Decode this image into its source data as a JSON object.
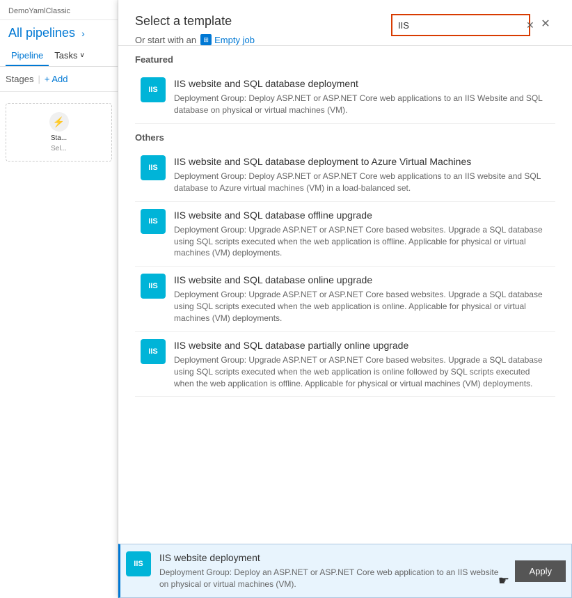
{
  "sidebar": {
    "project_name": "DemoYamlClassic",
    "title": "All pipelines",
    "breadcrumb_chevron": "›",
    "tabs": [
      {
        "label": "Pipeline",
        "active": true
      },
      {
        "label": "Tasks",
        "active": false,
        "chevron": "∨"
      }
    ],
    "stages_label": "Stages",
    "add_label": "+ Add",
    "stage": {
      "label": "Sta...",
      "sub_label": "Sel..."
    }
  },
  "modal": {
    "title": "Select a template",
    "subtitle_prefix": "Or start with an",
    "empty_job_label": "Empty job",
    "close_icon": "✕",
    "search_value": "IIS",
    "search_clear_icon": "✕",
    "featured_header": "Featured",
    "others_header": "Others",
    "featured_items": [
      {
        "badge": "IIS",
        "name": "IIS website and SQL database deployment",
        "description": "Deployment Group: Deploy ASP.NET or ASP.NET Core web applications to an IIS Website and SQL database on physical or virtual machines (VM)."
      }
    ],
    "other_items": [
      {
        "badge": "IIS",
        "name": "IIS website and SQL database deployment to Azure Virtual Machines",
        "description": "Deployment Group: Deploy ASP.NET or ASP.NET Core web applications to an IIS website and SQL database to Azure virtual machines (VM) in a load-balanced set."
      },
      {
        "badge": "IIS",
        "name": "IIS website and SQL database offline upgrade",
        "description": "Deployment Group: Upgrade ASP.NET or ASP.NET Core based websites. Upgrade a SQL database using SQL scripts executed when the web application is offline. Applicable for physical or virtual machines (VM) deployments."
      },
      {
        "badge": "IIS",
        "name": "IIS website and SQL database online upgrade",
        "description": "Deployment Group: Upgrade ASP.NET or ASP.NET Core based websites. Upgrade a SQL database using SQL scripts executed when the web application is online. Applicable for physical or virtual machines (VM) deployments."
      },
      {
        "badge": "IIS",
        "name": "IIS website and SQL database partially online upgrade",
        "description": "Deployment Group: Upgrade ASP.NET or ASP.NET Core based websites. Upgrade a SQL database using SQL scripts executed when the web application is online followed by SQL scripts executed when the web application is offline. Applicable for physical or virtual machines (VM) deployments."
      }
    ],
    "selected_item": {
      "badge": "IIS",
      "name": "IIS website deployment",
      "description": "Deployment Group: Deploy an ASP.NET or ASP.NET Core web application to an IIS website on physical or virtual machines (VM).",
      "apply_label": "Apply"
    }
  }
}
